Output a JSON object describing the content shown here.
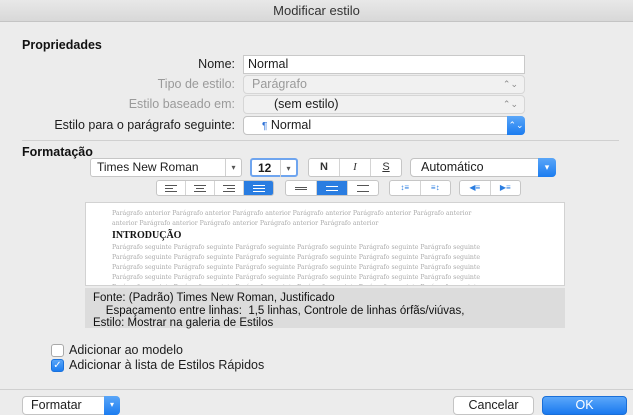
{
  "window": {
    "title": "Modificar estilo"
  },
  "properties": {
    "section_title": "Propriedades",
    "name_label": "Nome:",
    "name_value": "Normal",
    "style_type_label": "Tipo de estilo:",
    "style_type_value": "Parágrafo",
    "based_on_label": "Estilo baseado em:",
    "based_on_value": "(sem estilo)",
    "next_style_label": "Estilo para o parágrafo seguinte:",
    "next_style_icon": "¶",
    "next_style_value": "Normal"
  },
  "formatting": {
    "section_title": "Formatação",
    "font_name": "Times New Roman",
    "font_size": "12",
    "bold_label": "N",
    "italic_label": "I",
    "underline_label": "S",
    "color_value": "Automático"
  },
  "preview": {
    "previous_line_1": "Parágrafo anterior Parágrafo anterior Parágrafo anterior Parágrafo anterior Parágrafo anterior Parágrafo anterior",
    "previous_line_2": "anterior Parágrafo anterior Parágrafo anterior Parágrafo anterior Parágrafo anterior",
    "sample_text": "INTRODUÇÃO",
    "following_line": "Parágrafo seguinte Parágrafo seguinte Parágrafo seguinte Parágrafo seguinte Parágrafo seguinte Parágrafo seguinte"
  },
  "description": {
    "line1": "Fonte: (Padrão) Times New Roman, Justificado",
    "line2": "    Espaçamento entre linhas:  1,5 linhas, Controle de linhas órfãs/viúvas,",
    "line3": "Estilo: Mostrar na galeria de Estilos"
  },
  "options": {
    "add_to_template": {
      "label": "Adicionar ao modelo",
      "checked": false
    },
    "add_to_quick_styles": {
      "label": "Adicionar à lista de Estilos Rápidos",
      "checked": true
    }
  },
  "footer": {
    "format_label": "Formatar",
    "cancel_label": "Cancelar",
    "ok_label": "OK"
  },
  "colors": {
    "accent": "#1b7cf0"
  }
}
